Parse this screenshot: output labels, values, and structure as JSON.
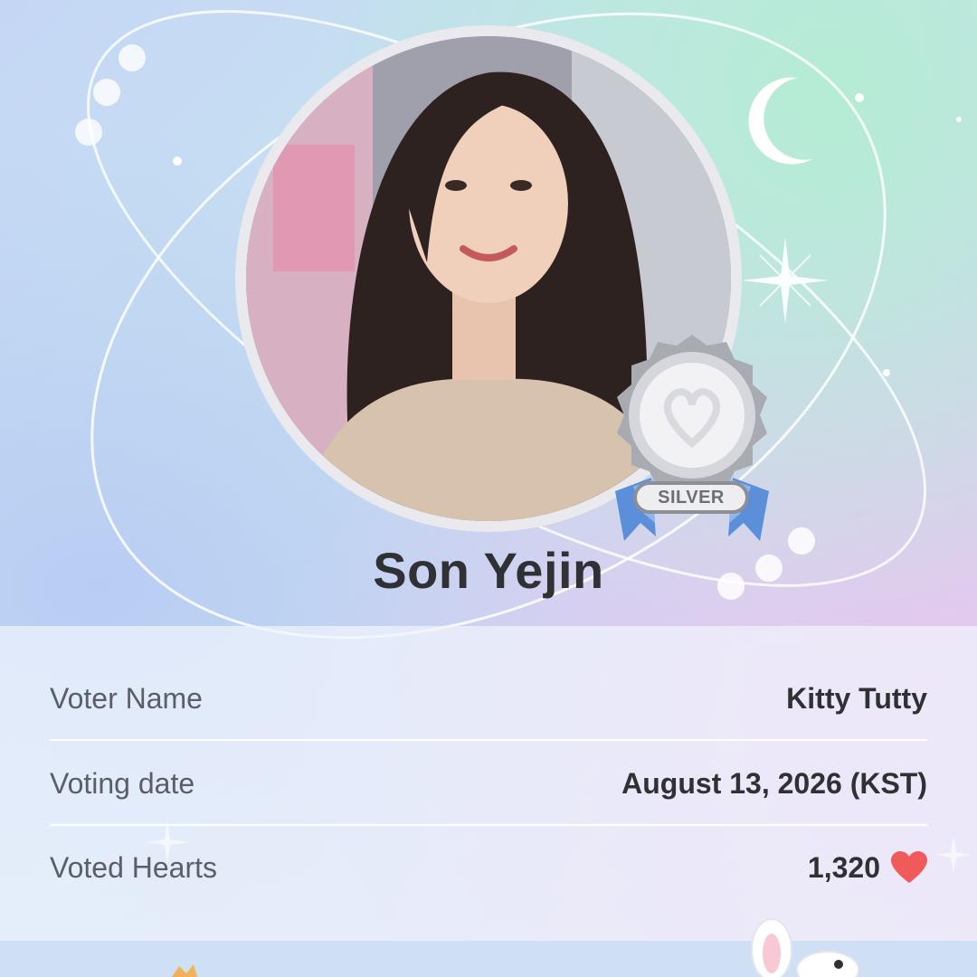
{
  "card": {
    "name": "Son Yejin",
    "badge": "SILVER"
  },
  "details": [
    {
      "label": "Voter Name",
      "value": "Kitty Tutty"
    },
    {
      "label": "Voting date",
      "value": "August 13, 2026 (KST)"
    },
    {
      "label": "Voted Hearts",
      "value": "1,320"
    }
  ],
  "colors": {
    "heart": "#f05a5a",
    "ribbon": "#5b8fd9",
    "medal": "#c9cace",
    "title": "#2f3135"
  },
  "icons": [
    "moon-icon",
    "sparkle-icon",
    "heart-icon",
    "bunny-icon"
  ]
}
